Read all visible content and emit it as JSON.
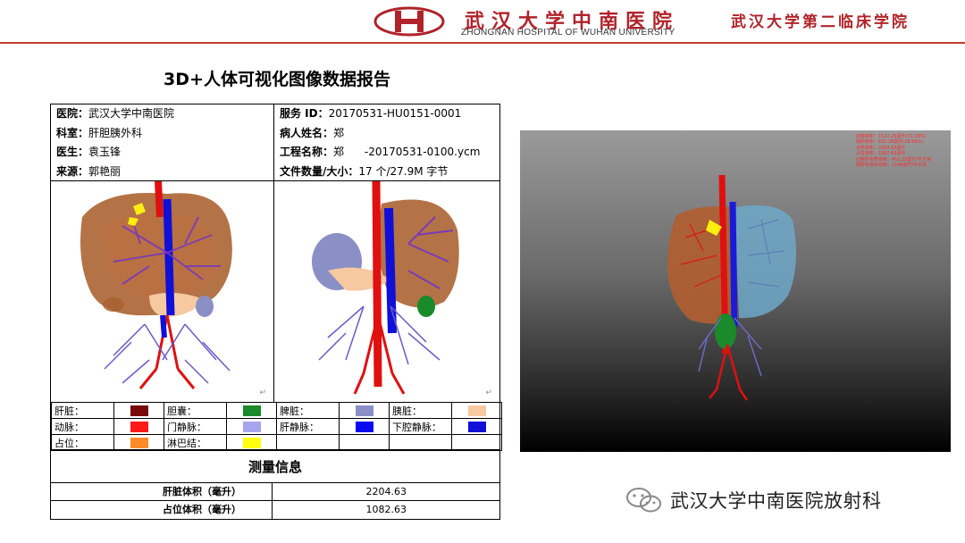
{
  "header": {
    "hospital_cn": "武汉大学中南医院",
    "hospital_en": "ZHONGNAN HOSPITAL OF WUHAN UNIVERSITY",
    "subtitle": "武汉大学第二临床学院"
  },
  "report": {
    "title": "3D+人体可视化图像数据报告",
    "info_left": [
      {
        "key": "医院：",
        "value": "武汉大学中南医院"
      },
      {
        "key": "科室：",
        "value": "肝胆胰外科"
      },
      {
        "key": "医生：",
        "value": "袁玉锋"
      },
      {
        "key": "来源：",
        "value": "郭艳丽"
      }
    ],
    "info_right": [
      {
        "key": "服务 ID：",
        "value": "20170531-HU0151-0001"
      },
      {
        "key": "病人姓名：",
        "value": "郑"
      },
      {
        "key": "工程名称：",
        "value": "郑      -20170531-0100.ycm"
      },
      {
        "key": "文件数量/大小：",
        "value": "17 个/27.9M 字节"
      }
    ],
    "legend": [
      [
        {
          "label": "肝脏：",
          "color": "#7a0a0a"
        },
        {
          "label": "胆囊：",
          "color": "#1a8a2a"
        },
        {
          "label": "脾脏：",
          "color": "#8a8fc6"
        },
        {
          "label": "胰脏：",
          "color": "#f7c9a0"
        }
      ],
      [
        {
          "label": "动脉：",
          "color": "#ff1a1a"
        },
        {
          "label": "门静脉：",
          "color": "#a8a4f0"
        },
        {
          "label": "肝静脉：",
          "color": "#0a0af0"
        },
        {
          "label": "下腔静脉：",
          "color": "#1010d8"
        }
      ],
      [
        {
          "label": "占位：",
          "color": "#ff8a2a"
        },
        {
          "label": "淋巴结：",
          "color": "#ffff10"
        },
        {
          "label": "",
          "color": ""
        },
        {
          "label": "",
          "color": ""
        }
      ]
    ],
    "measure_title": "测量信息",
    "measurements": [
      {
        "label": "肝脏体积（毫升）",
        "value": "2204.63"
      },
      {
        "label": "占位体积（毫升）",
        "value": "1082.63"
      }
    ]
  },
  "viewer": {
    "stats": [
      "切除体积：1522.25毫升(71.38%)",
      "残肝体积：632.38毫升(28.69%)",
      "全肝体积：2204.63毫升",
      "占位体积：1082.63毫升",
      "切除肝实质体积：452.25毫升/平方米",
      "残肝标准化体积：1148毫升/平方米"
    ]
  },
  "footer": {
    "wechat_label": "武汉大学中南医院放射科"
  },
  "colors": {
    "brand_red": "#b0232a",
    "liver": "#8b4a2a",
    "artery": "#e01010",
    "portal_vein": "#7a5ac8",
    "hepatic_vein": "#1010d8"
  }
}
